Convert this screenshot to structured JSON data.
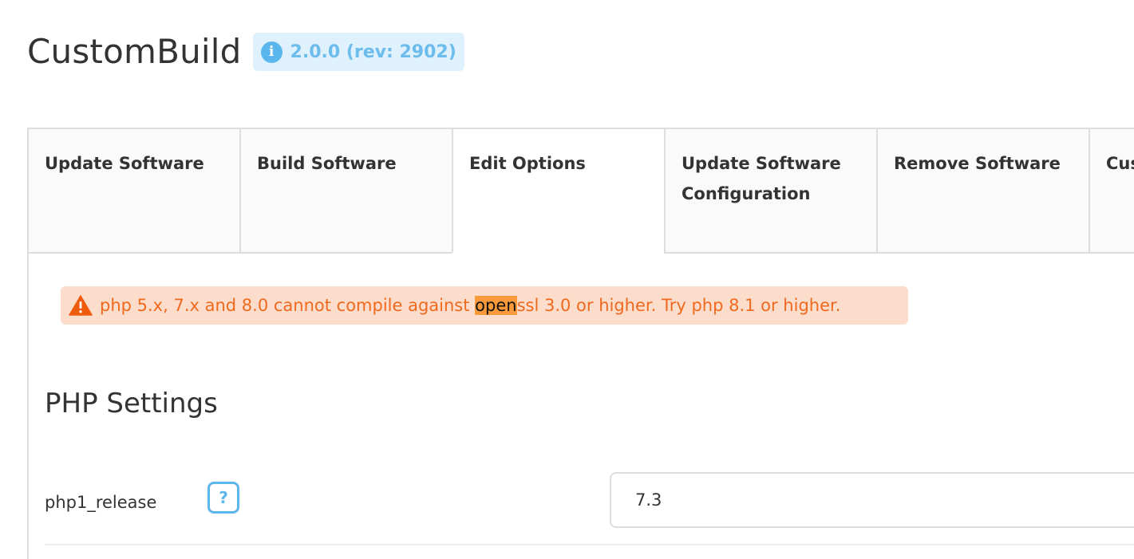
{
  "header": {
    "title": "CustomBuild",
    "version_icon": "info-icon",
    "version": "2.0.0 (rev: 2902)"
  },
  "tabs": [
    {
      "label": "Update Software",
      "active": false
    },
    {
      "label": "Build Software",
      "active": false
    },
    {
      "label": "Edit Options",
      "active": true
    },
    {
      "label": "Update Software Configuration",
      "active": false
    },
    {
      "label": "Remove Software",
      "active": false
    },
    {
      "label": "Custom Functions",
      "active": false
    }
  ],
  "alert": {
    "icon": "warning-icon",
    "text_before": "php 5.x, 7.x and 8.0 cannot compile against ",
    "text_highlight": "open",
    "text_after": "ssl 3.0 or higher. Try php 8.1 or higher."
  },
  "section": {
    "title": "PHP Settings"
  },
  "settings": [
    {
      "label": "php1_release",
      "help": "?",
      "value": "7.3"
    }
  ],
  "colors": {
    "accent": "#5ab6ec",
    "warning_text": "#ef6a1e",
    "warning_bg": "#fcdccb",
    "highlight": "#fb9a3a"
  }
}
